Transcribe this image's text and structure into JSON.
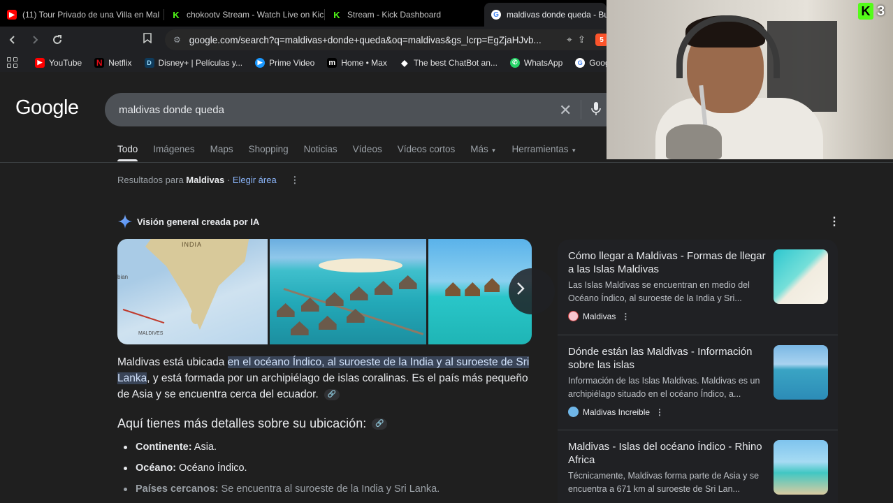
{
  "browser": {
    "tabs": [
      {
        "title": "(11) Tour Privado de una Villa en Mal",
        "favicon": "youtube-icon",
        "active": false
      },
      {
        "title": "chokootv Stream - Watch Live on Kic",
        "favicon": "kick-icon",
        "active": false
      },
      {
        "title": "Stream - Kick Dashboard",
        "favicon": "kick-icon",
        "active": false
      },
      {
        "title": "maldivas donde queda - Bus",
        "favicon": "google-icon",
        "active": true
      }
    ],
    "url": "google.com/search?q=maldivas+donde+queda&oq=maldivas&gs_lcrp=EgZjaHJvb...",
    "brave_badge": "5",
    "bookmarks": [
      {
        "label": "YouTube",
        "icon": "youtube-icon",
        "color": "#ff0000"
      },
      {
        "label": "Netflix",
        "icon": "netflix-icon",
        "color": "#e50914"
      },
      {
        "label": "Disney+ | Películas y...",
        "icon": "disney-icon",
        "color": "#1a3c8f"
      },
      {
        "label": "Prime Video",
        "icon": "prime-video-icon",
        "color": "#1a98ff"
      },
      {
        "label": "Home • Max",
        "icon": "max-icon",
        "color": "#111111"
      },
      {
        "label": "The best ChatBot an...",
        "icon": "chatbot-icon",
        "color": "#444444"
      },
      {
        "label": "WhatsApp",
        "icon": "whatsapp-icon",
        "color": "#25d366"
      },
      {
        "label": "Google",
        "icon": "google-icon",
        "color": "#4285f4"
      }
    ]
  },
  "google": {
    "logo": "Google",
    "query": "maldivas donde queda",
    "tabs": [
      "Todo",
      "Imágenes",
      "Maps",
      "Shopping",
      "Noticias",
      "Vídeos",
      "Vídeos cortos",
      "Más",
      "Herramientas"
    ],
    "results_for_prefix": "Resultados para",
    "results_for_place": "Maldivas",
    "results_for_sep": "·",
    "choose_area": "Elegir área"
  },
  "ai_overview": {
    "title": "Visión general creada por IA",
    "map_labels": {
      "india": "INDIA",
      "maldives": "MALDIVES",
      "arabian": "bian"
    },
    "text_pre": "Maldivas está ubicada ",
    "text_highlight": "en el océano Índico, al suroeste de la India y al suroeste de Sri Lanka",
    "text_post": ", y está formada por un archipiélago de islas coralinas. Es el país más pequeño de Asia y se encuentra cerca del ecuador.",
    "details_heading": "Aquí tienes más detalles sobre su ubicación:",
    "details": [
      {
        "key": "Continente:",
        "value": " Asia."
      },
      {
        "key": "Océano:",
        "value": " Océano Índico."
      },
      {
        "key": "Países cercanos:",
        "value": " Se encuentra al suroeste de la India y Sri Lanka."
      }
    ]
  },
  "sources": [
    {
      "title": "Cómo llegar a Maldivas - Formas de llegar a las Islas Maldivas",
      "snippet": "Las Islas Maldivas se encuentran en medio del Océano Índico, al suroeste de la India y Sri...",
      "site": "Maldivas",
      "site_color": "#e8a0b0"
    },
    {
      "title": "Dónde están las Maldivas - Información sobre las islas",
      "snippet": "Información de las Islas Maldivas. Maldivas es un archipiélago situado en el océano Índico, a...",
      "site": "Maldivas Increible",
      "site_color": "#6fb6e8"
    },
    {
      "title": "Maldivas - Islas del océano Índico - Rhino Africa",
      "snippet": "Técnicamente, Maldivas forma parte de Asia y se encuentra a 671 km al suroeste de Sri Lan...",
      "site": "",
      "site_color": "#9aa0a6"
    }
  ],
  "stream_overlay": {
    "kick_letter": "K",
    "viewer_count": "3"
  }
}
